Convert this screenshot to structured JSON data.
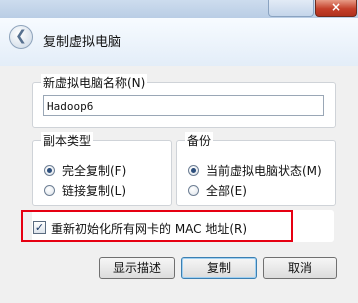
{
  "titlebar": {
    "close_glyph": "×"
  },
  "header": {
    "title": "复制虚拟电脑"
  },
  "name_group": {
    "legend": "新虚拟电脑名称(N)",
    "value": "Hadoop6"
  },
  "copy_type": {
    "legend": "副本类型",
    "options": [
      {
        "label": "完全复制(F)",
        "selected": true
      },
      {
        "label": "链接复制(L)",
        "selected": false
      }
    ]
  },
  "snapshots": {
    "legend": "备份",
    "options": [
      {
        "label": "当前虚拟电脑状态(M)",
        "selected": true
      },
      {
        "label": "全部(E)",
        "selected": false
      }
    ]
  },
  "reinit_mac": {
    "label": "重新初始化所有网卡的 MAC 地址(R)",
    "checked": true,
    "highlight_color": "#e60012"
  },
  "buttons": {
    "describe": "显示描述",
    "clone": "复制",
    "cancel": "取消"
  },
  "icons": {
    "back": "back-arrow-icon",
    "check": "checkmark-icon"
  }
}
